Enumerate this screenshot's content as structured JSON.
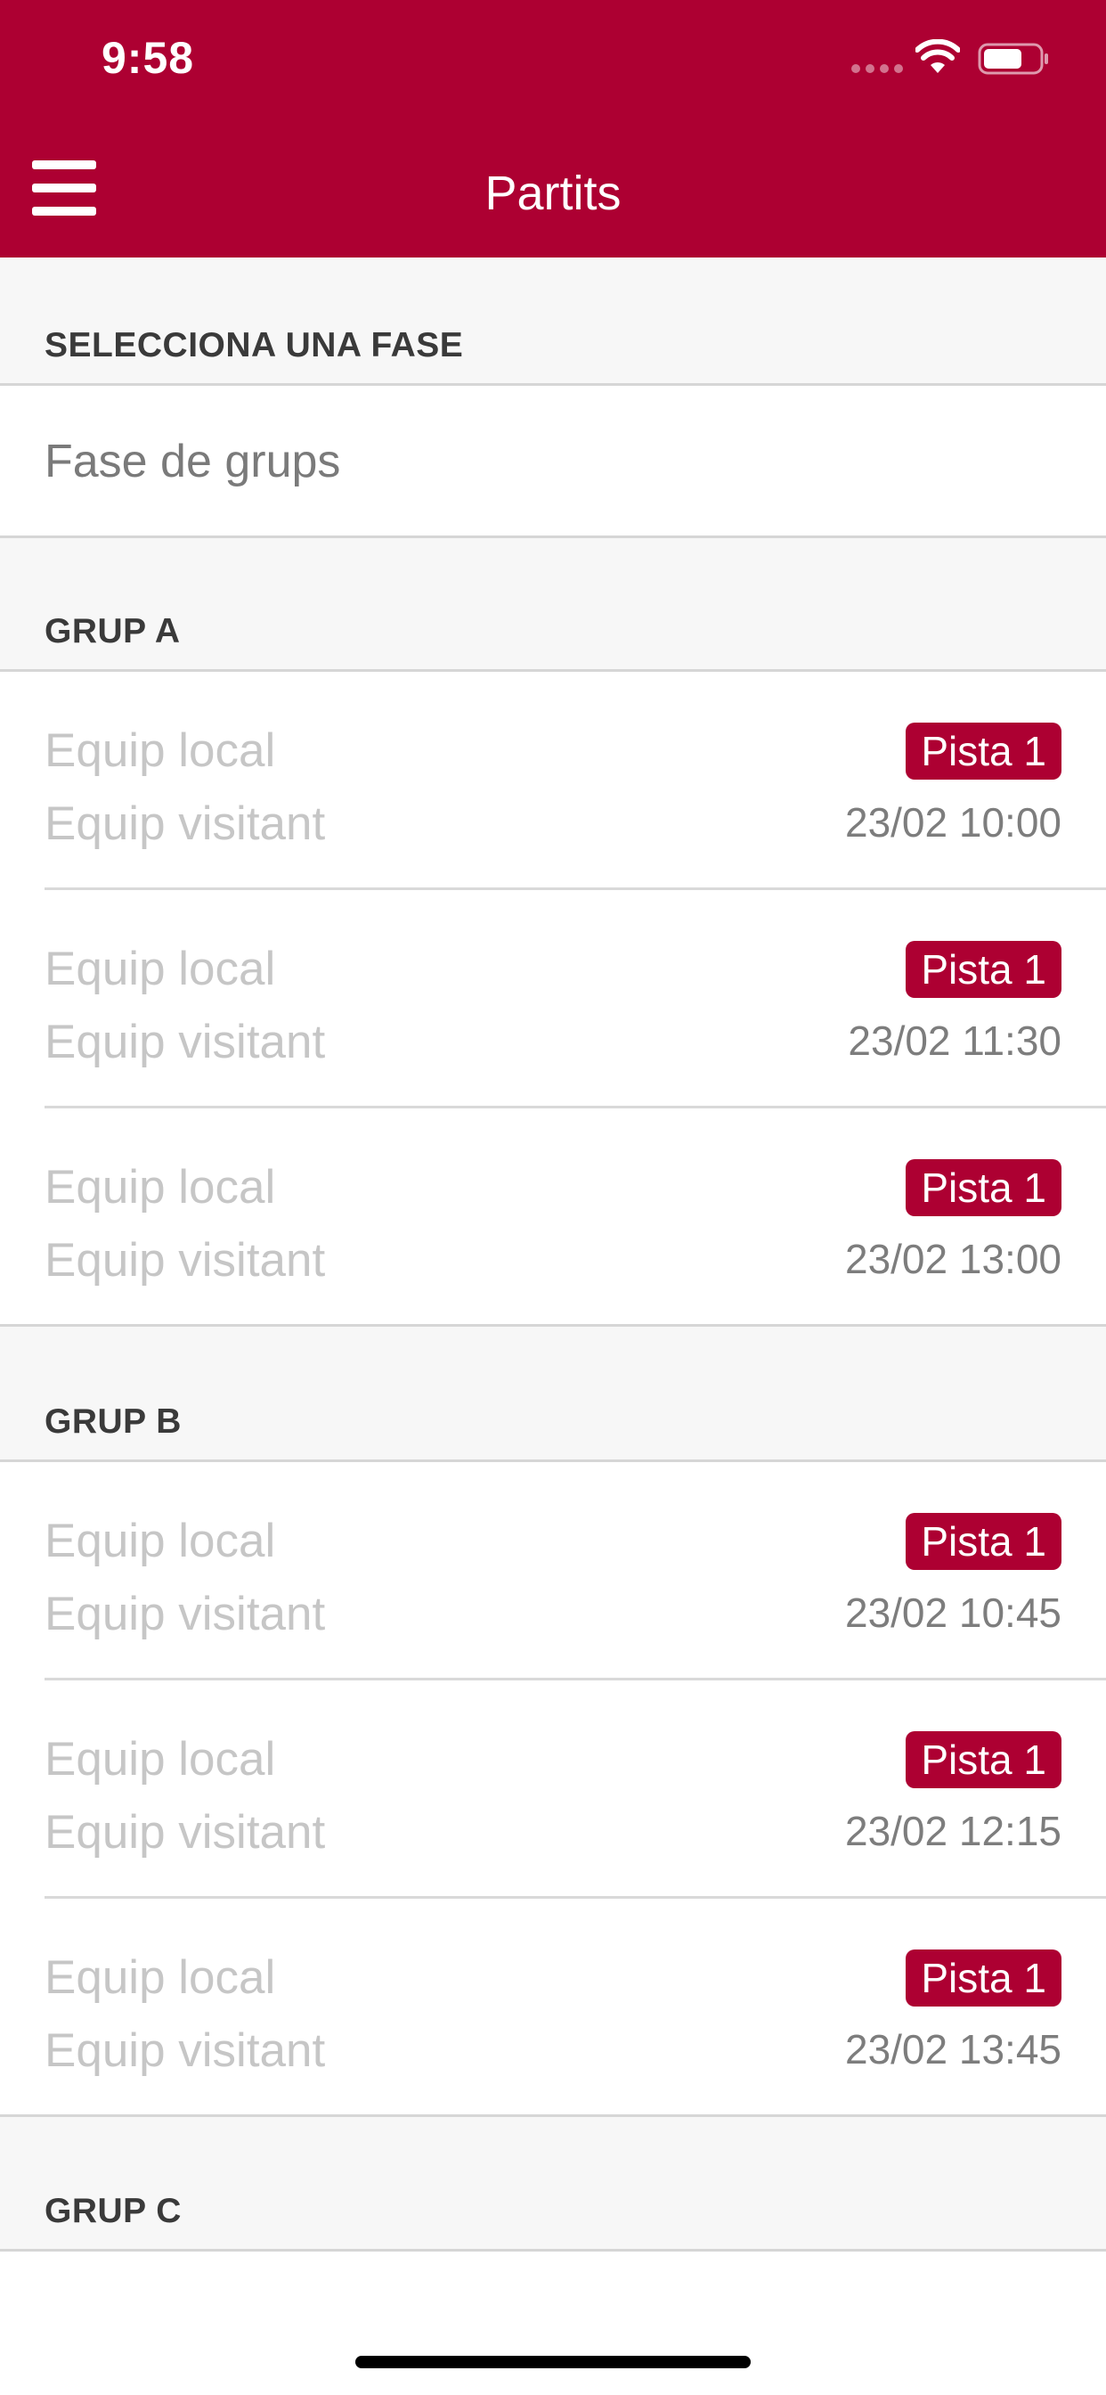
{
  "status_bar": {
    "time": "9:58"
  },
  "header": {
    "title": "Partits",
    "background": "#ad0032"
  },
  "phase": {
    "section_label": "SELECCIONA UNA FASE",
    "selected": "Fase de grups"
  },
  "groups": [
    {
      "name": "GRUP A",
      "matches": [
        {
          "home": "Equip local",
          "away": "Equip visitant",
          "court": "Pista 1",
          "datetime": "23/02 10:00"
        },
        {
          "home": "Equip local",
          "away": "Equip visitant",
          "court": "Pista 1",
          "datetime": "23/02 11:30"
        },
        {
          "home": "Equip local",
          "away": "Equip visitant",
          "court": "Pista 1",
          "datetime": "23/02 13:00"
        }
      ]
    },
    {
      "name": "GRUP B",
      "matches": [
        {
          "home": "Equip local",
          "away": "Equip visitant",
          "court": "Pista 1",
          "datetime": "23/02 10:45"
        },
        {
          "home": "Equip local",
          "away": "Equip visitant",
          "court": "Pista 1",
          "datetime": "23/02 12:15"
        },
        {
          "home": "Equip local",
          "away": "Equip visitant",
          "court": "Pista 1",
          "datetime": "23/02 13:45"
        }
      ]
    },
    {
      "name": "GRUP C",
      "matches": []
    }
  ]
}
